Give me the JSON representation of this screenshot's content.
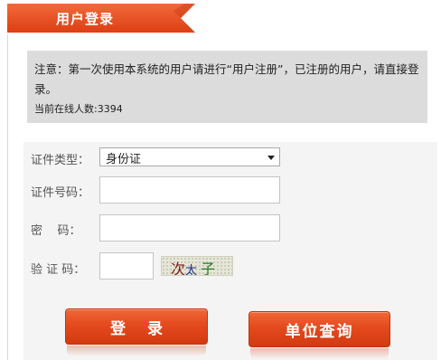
{
  "header": {
    "title": "用户登录"
  },
  "notice": {
    "text": "注意：第一次使用本系统的用户请进行“用户注册”，已注册的用户，请直接登录。",
    "online_label": "当前在线人数:",
    "online_count": "3394"
  },
  "form": {
    "id_type": {
      "label": "证件类型：",
      "value": "身份证"
    },
    "id_number": {
      "label": "证件号码：",
      "value": ""
    },
    "password": {
      "label": "密    码：",
      "value": ""
    },
    "captcha": {
      "label": "验 证 码：",
      "value": "",
      "image_text": [
        "次",
        "太",
        "子"
      ]
    }
  },
  "buttons": {
    "login": "登录",
    "unit_query": "单位查询"
  },
  "colors": {
    "accent": "#e4491d",
    "notice_bg": "#dcdcdc",
    "panel_bg": "#f4f4f4"
  }
}
